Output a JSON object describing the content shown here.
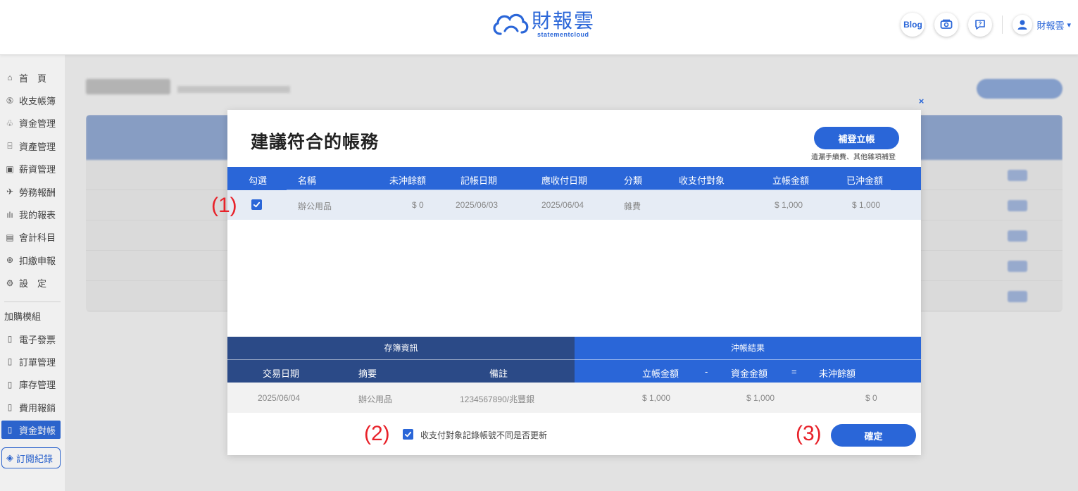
{
  "header": {
    "logo_text": "財報雲",
    "logo_sub": "statementcloud",
    "blog_label": "Blog",
    "user_name": "財報雲"
  },
  "sidebar": {
    "items": [
      {
        "label": "首　頁",
        "icon": "home-icon"
      },
      {
        "label": "收支帳簿",
        "icon": "dollar-icon"
      },
      {
        "label": "資金管理",
        "icon": "money-bag-icon"
      },
      {
        "label": "資產管理",
        "icon": "bank-icon"
      },
      {
        "label": "薪資管理",
        "icon": "wallet-icon"
      },
      {
        "label": "勞務報酬",
        "icon": "handshake-icon"
      },
      {
        "label": "我的報表",
        "icon": "bar-chart-icon"
      },
      {
        "label": "會計科目",
        "icon": "ledger-icon"
      },
      {
        "label": "扣繳申報",
        "icon": "tax-icon"
      },
      {
        "label": "設　定",
        "icon": "settings-icon"
      }
    ],
    "group_label": "加購模組",
    "modules": [
      {
        "label": "電子發票"
      },
      {
        "label": "訂單管理"
      },
      {
        "label": "庫存管理"
      },
      {
        "label": "費用報銷"
      },
      {
        "label": "資金對帳",
        "active": true
      }
    ],
    "subscription_label": "訂閱紀錄"
  },
  "modal": {
    "title": "建議符合的帳務",
    "add_button": "補登立帳",
    "add_note": "遺漏手續費、其他雜項補登",
    "columns": [
      "勾選",
      "名稱",
      "未沖餘額",
      "記帳日期",
      "應收付日期",
      "分類",
      "收支付對象",
      "立帳金額",
      "已沖金額"
    ],
    "rows": [
      {
        "name": "辦公用品",
        "unsettled": "$ 0",
        "record_date": "2025/06/03",
        "due_date": "2025/06/04",
        "category": "雜費",
        "counterparty": "",
        "amount": "$ 1,000",
        "settled": "$ 1,000",
        "checked": true
      }
    ],
    "deposit_section": "存簿資訊",
    "result_section": "沖帳結果",
    "deposit_columns": [
      "交易日期",
      "摘要",
      "備註"
    ],
    "result_columns": [
      "立帳金額",
      "-",
      "資金金額",
      "=",
      "未沖餘額"
    ],
    "deposit_row": {
      "date": "2025/06/04",
      "summary": "辦公用品",
      "note": "1234567890/兆豐銀"
    },
    "result_row": {
      "amount": "$ 1,000",
      "fund": "$ 1,000",
      "remaining": "$ 0"
    },
    "update_label": "收支付對象記錄帳號不同是否更新",
    "confirm_button": "確定",
    "close_label": "×"
  },
  "annotations": [
    "(1)",
    "(2)",
    "(3)"
  ],
  "colors": {
    "primary": "#2a66d8",
    "dark_section": "#2b4a87",
    "annotation": "#e8222a"
  }
}
